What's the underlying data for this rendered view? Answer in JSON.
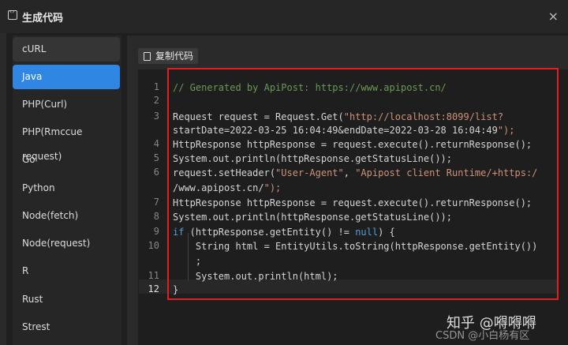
{
  "window": {
    "title": "生成代码",
    "close": "×"
  },
  "sidebar": {
    "items": [
      {
        "label": "cURL"
      },
      {
        "label": "Java"
      },
      {
        "label": "PHP(Curl)"
      },
      {
        "label": "PHP(Rmccue request)"
      },
      {
        "label": "Go"
      },
      {
        "label": "Python"
      },
      {
        "label": "Node(fetch)"
      },
      {
        "label": "Node(request)"
      },
      {
        "label": "R"
      },
      {
        "label": "Rust"
      },
      {
        "label": "Strest"
      }
    ],
    "selected": "Java"
  },
  "toolbar": {
    "copy_label": "复制代码"
  },
  "editor": {
    "line_numbers": [
      "1",
      "2",
      "3",
      "",
      "4",
      "5",
      "6",
      "",
      "7",
      "8",
      "9",
      "10",
      "",
      "11",
      "12"
    ],
    "current_line": "12",
    "lines": [
      "// Generated by ApiPost: https://www.apipost.cn/",
      "",
      "Request request = Request.Get(\"http://localhost:8099/list?",
      "startDate=2022-03-25 16:04:49&endDate=2022-03-28 16:04:49\");",
      "HttpResponse httpResponse = request.execute().returnResponse();",
      "System.out.println(httpResponse.getStatusLine());",
      "request.setHeader(\"User-Agent\", \"Apipost client Runtime/+https:/",
      "/www.apipost.cn/\");",
      "HttpResponse httpResponse = request.execute().returnResponse();",
      "System.out.println(httpResponse.getStatusLine());",
      "if (httpResponse.getEntity() != null) {",
      "    String html = EntityUtils.toString(httpResponse.getEntity())",
      "    ;",
      "    System.out.println(html);",
      "}"
    ]
  },
  "watermark": {
    "line1": "知乎 @嘚嘚嘚",
    "line2": "CSDN @小白杨有区"
  }
}
